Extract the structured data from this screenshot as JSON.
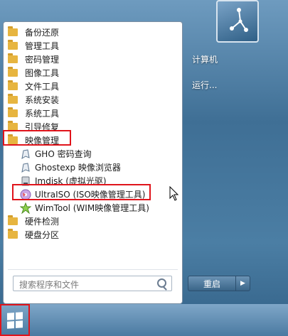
{
  "start_menu": {
    "programs": [
      {
        "label": "备份还原",
        "type": "folder"
      },
      {
        "label": "管理工具",
        "type": "folder"
      },
      {
        "label": "密码管理",
        "type": "folder"
      },
      {
        "label": "图像工具",
        "type": "folder"
      },
      {
        "label": "文件工具",
        "type": "folder"
      },
      {
        "label": "系统安装",
        "type": "folder"
      },
      {
        "label": "系统工具",
        "type": "folder"
      },
      {
        "label": "引导修复",
        "type": "folder"
      },
      {
        "label": "映像管理",
        "type": "folder",
        "highlighted": true
      },
      {
        "label": "GHO 密码查询",
        "type": "app",
        "icon": "ghost-icon"
      },
      {
        "label": "Ghostexp 映像浏览器",
        "type": "app",
        "icon": "ghost-icon"
      },
      {
        "label": "Imdisk (虚拟光驱)",
        "type": "app",
        "icon": "disk-icon"
      },
      {
        "label": "UltraISO (ISO映像管理工具)",
        "type": "app",
        "icon": "ultraiso-icon",
        "highlighted": true
      },
      {
        "label": "WimTool (WIM映像管理工具)",
        "type": "app",
        "icon": "wimtool-icon"
      },
      {
        "label": "硬件检测",
        "type": "folder"
      },
      {
        "label": "硬盘分区",
        "type": "folder"
      }
    ],
    "search_placeholder": "搜索程序和文件",
    "right_items": [
      {
        "label": "计算机"
      },
      {
        "label": "运行..."
      }
    ],
    "restart_label": "重启",
    "restart_arrow": "▶"
  },
  "colors": {
    "highlight_border": "#e0141b",
    "folder": "#e7b540"
  }
}
